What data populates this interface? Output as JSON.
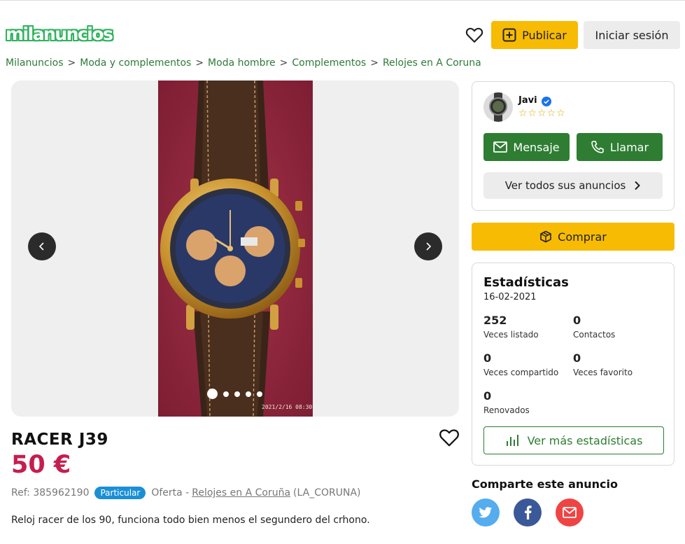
{
  "header": {
    "logo_text": "milanuncios",
    "publish_label": "Publicar",
    "login_label": "Iniciar sesión"
  },
  "breadcrumb": {
    "items": [
      "Milanuncios",
      "Moda y complementos",
      "Moda hombre",
      "Complementos",
      "Relojes en A Coruna"
    ],
    "separator": ">"
  },
  "gallery": {
    "photo_count": 5,
    "active_index": 0,
    "photo_timestamp": "2021/2/16 08:30"
  },
  "ad": {
    "title": "RACER J39",
    "price": "50 €",
    "ref_label": "Ref:",
    "ref_value": "385962190",
    "seller_type": "Particular",
    "offer_label": "Oferta -",
    "category_link": "Relojes en A Coruña",
    "region": "(LA_CORUNA)",
    "description": "Reloj racer de los 90, funciona todo bien menos el segundero del crhono."
  },
  "seller": {
    "name": "Javi",
    "rating_stars": "☆☆☆☆☆",
    "message_label": "Mensaje",
    "call_label": "Llamar",
    "all_ads_label": "Ver todos sus anuncios"
  },
  "buy": {
    "label": "Comprar"
  },
  "stats": {
    "title": "Estadísticas",
    "date": "16-02-2021",
    "items": [
      {
        "value": "252",
        "label": "Veces listado"
      },
      {
        "value": "0",
        "label": "Contactos"
      },
      {
        "value": "0",
        "label": "Veces compartido"
      },
      {
        "value": "0",
        "label": "Veces favorito"
      },
      {
        "value": "0",
        "label": "Renovados"
      }
    ],
    "more_label": "Ver más estadísticas"
  },
  "share": {
    "title": "Comparte este anuncio"
  },
  "colors": {
    "brand_green": "#2fb35d",
    "action_yellow": "#f7bb04",
    "button_green": "#2e7d32",
    "price_red": "#c51e4e",
    "badge_blue": "#1a8fd6"
  }
}
